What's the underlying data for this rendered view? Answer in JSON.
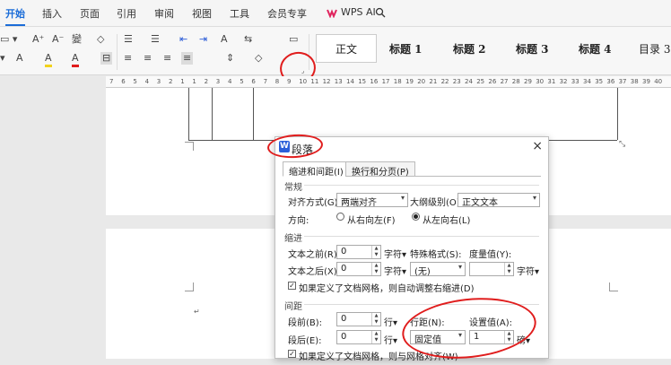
{
  "menu": {
    "items": [
      "开始",
      "插入",
      "页面",
      "引用",
      "审阅",
      "视图",
      "工具",
      "会员专享",
      "WPS AI"
    ],
    "active_index": 0
  },
  "ribbon": {
    "row1": [
      "A⁺",
      "A⁻",
      "變",
      "◇",
      "☰",
      "☰",
      "⇤",
      "⇥",
      "A",
      "⇆",
      "▭"
    ],
    "row2": [
      "A",
      "A",
      "A",
      "⊟",
      "≡",
      "≡",
      "≡",
      "≡",
      "⇕",
      "◇"
    ],
    "styles": [
      "正文",
      "标题 1",
      "标题 2",
      "标题 3",
      "标题 4",
      "目录 3"
    ]
  },
  "ruler": {
    "ticks": [
      "7",
      "6",
      "5",
      "4",
      "3",
      "2",
      "1",
      "1",
      "2",
      "3",
      "4",
      "5",
      "6",
      "7",
      "8",
      "9",
      "10",
      "11",
      "12",
      "13",
      "14",
      "15",
      "16",
      "17",
      "18",
      "19",
      "20",
      "21",
      "22",
      "23",
      "24",
      "25",
      "26",
      "27",
      "28",
      "29",
      "30",
      "31",
      "32",
      "33",
      "34",
      "35",
      "36",
      "37",
      "38",
      "39",
      "40"
    ]
  },
  "dialog": {
    "title": "段落",
    "close": "×",
    "tabs": [
      "缩进和间距(I)",
      "换行和分页(P)"
    ],
    "general": {
      "section": "常规",
      "align_label": "对齐方式(G):",
      "align_value": "两端对齐",
      "outline_label": "大纲级别(O):",
      "outline_value": "正文文本",
      "direction_label": "方向:",
      "rtl_label": "从右向左(F)",
      "ltr_label": "从左向右(L)"
    },
    "indent": {
      "section": "缩进",
      "before_label": "文本之前(R):",
      "before_value": "0",
      "before_unit": "字符",
      "after_label": "文本之后(X):",
      "after_value": "0",
      "after_unit": "字符",
      "special_label": "特殊格式(S):",
      "special_value": "(无)",
      "measure_label": "度量值(Y):",
      "measure_value": "",
      "measure_unit": "字符",
      "grid_check_label": "如果定义了文档网格，则自动调整右缩进(D)"
    },
    "spacing": {
      "section": "间距",
      "before_label": "段前(B):",
      "before_value": "0",
      "before_unit": "行",
      "after_label": "段后(E):",
      "after_value": "0",
      "after_unit": "行",
      "line_label": "行距(N):",
      "line_value": "固定值",
      "set_label": "设置值(A):",
      "set_value": "1",
      "set_unit": "磅",
      "grid_check_label": "如果定义了文档网格，则与网格对齐(W)"
    }
  },
  "colors": {
    "accent": "#1a6cd8",
    "annotation": "#e01d1d",
    "dialog_icon": "#2b5fd9"
  }
}
